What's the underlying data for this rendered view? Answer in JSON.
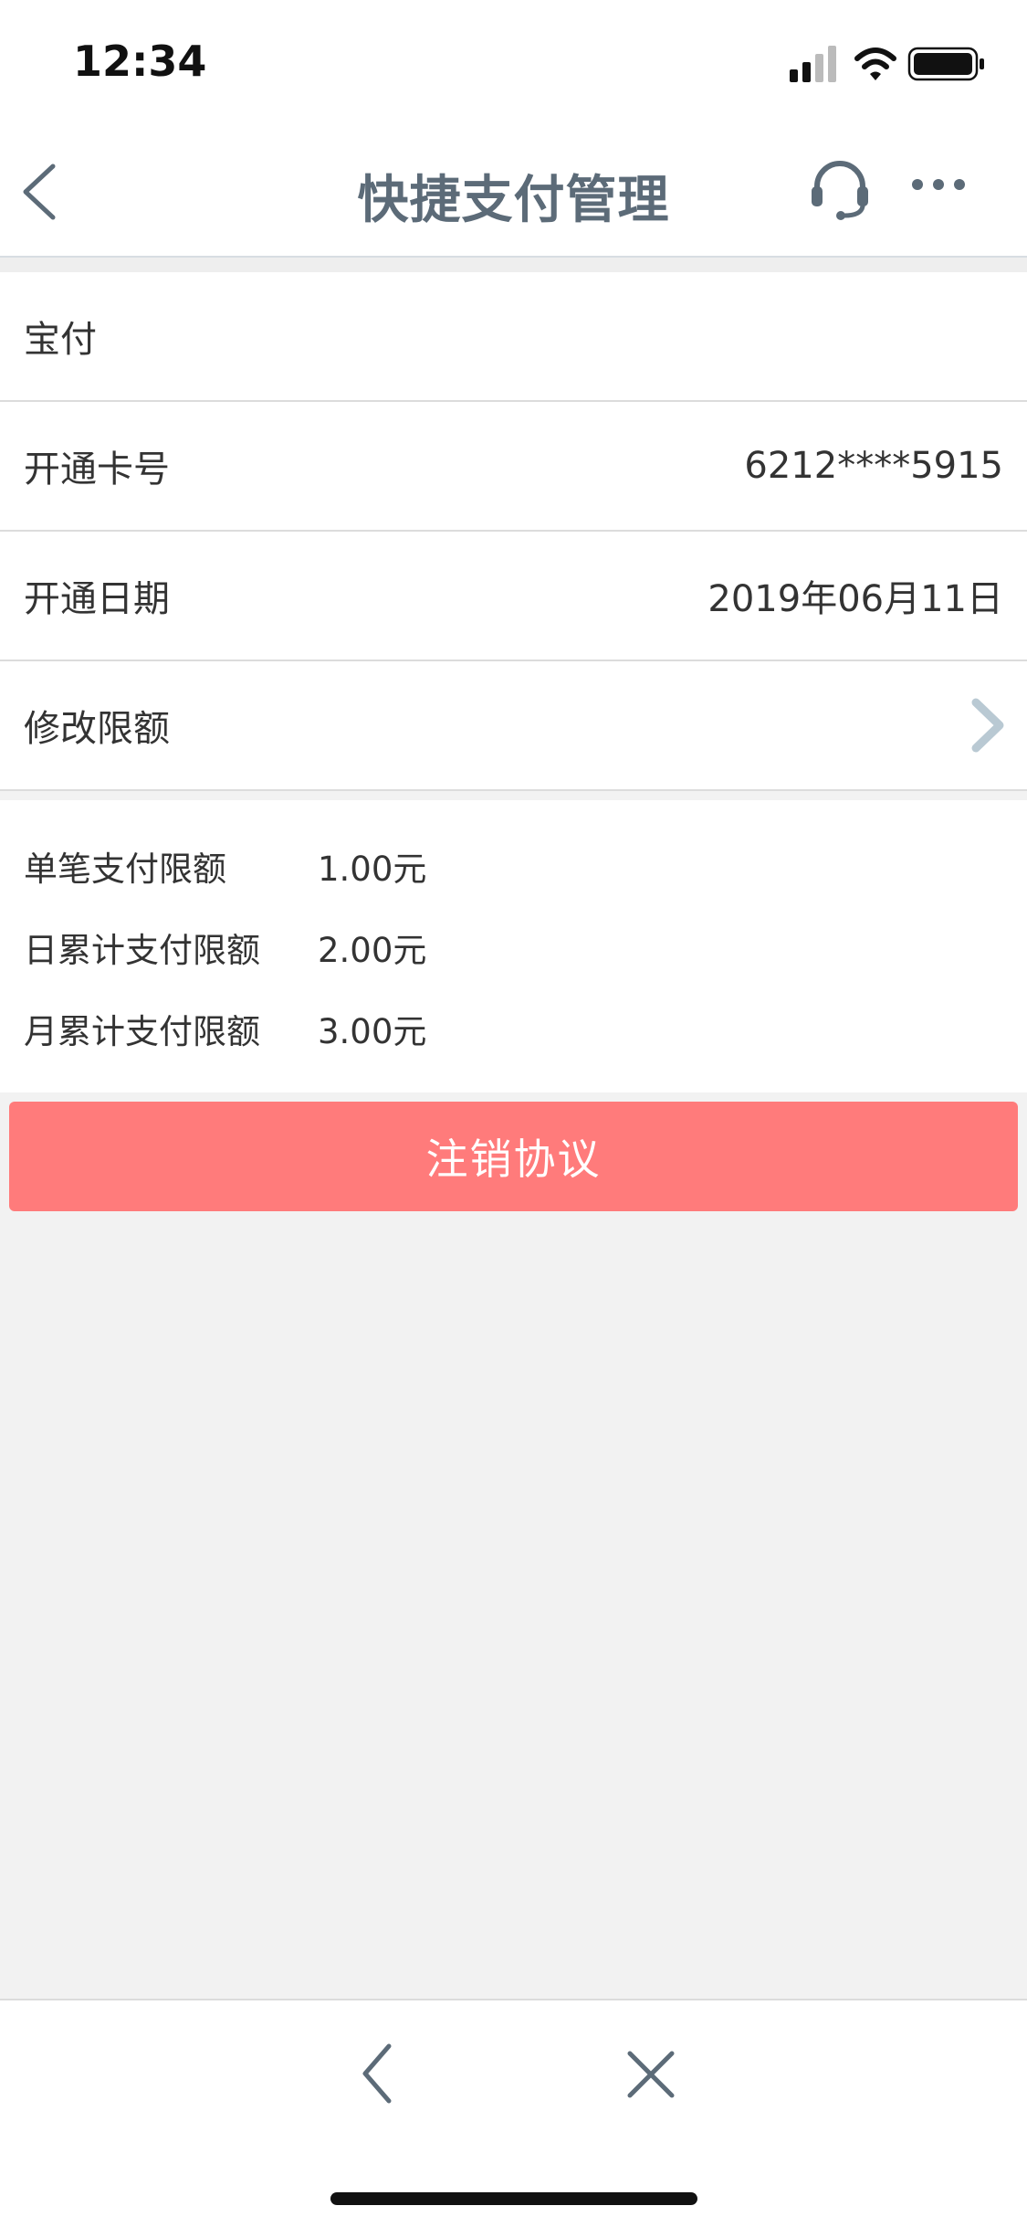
{
  "status_bar": {
    "time": "12:34"
  },
  "nav": {
    "title": "快捷支付管理",
    "back_icon": "chevron-left-icon",
    "support_icon": "headset-icon",
    "more_icon": "more-dots-icon"
  },
  "info": {
    "merchant": "宝付",
    "card_label": "开通卡号",
    "card_value": "6212****5915",
    "date_label": "开通日期",
    "date_value": "2019年06月11日",
    "modify_label": "修改限额"
  },
  "limits": [
    {
      "label": "单笔支付限额",
      "value": "1.00元"
    },
    {
      "label": "日累计支付限额",
      "value": "2.00元"
    },
    {
      "label": "月累计支付限额",
      "value": "3.00元"
    }
  ],
  "actions": {
    "cancel_label": "注销协议"
  },
  "colors": {
    "accent": "#ff7b7b",
    "title": "#5c6b78",
    "chevron": "#b9c9d3",
    "background": "#f2f2f2"
  }
}
